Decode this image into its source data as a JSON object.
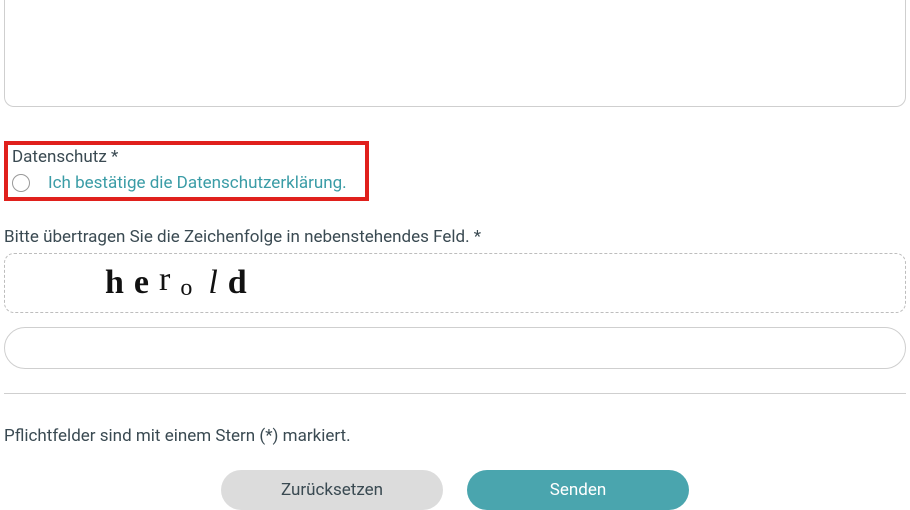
{
  "privacy": {
    "label": "Datenschutz *",
    "link_text": "Ich bestätige die Datenschutzerklärung."
  },
  "captcha": {
    "label": "Bitte übertragen Sie die Zeichenfolge in nebenstehendes Feld. *",
    "chars": {
      "c1": "h",
      "c2": "e",
      "c3": "r",
      "c4": "o",
      "c5": "l",
      "c6": "d"
    },
    "input_value": ""
  },
  "required_note": "Pflichtfelder sind mit einem Stern (*) markiert.",
  "buttons": {
    "reset": "Zurücksetzen",
    "submit": "Senden"
  }
}
